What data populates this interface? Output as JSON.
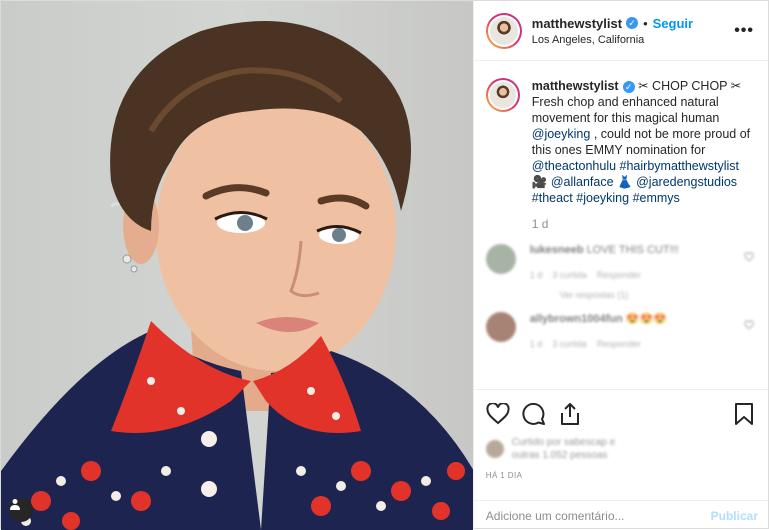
{
  "header": {
    "username": "matthewstylist",
    "verified_icon": "verified-badge-icon",
    "separator": "•",
    "follow_label": "Seguir",
    "location": "Los Angeles, California",
    "more_label": "•••"
  },
  "caption": {
    "username": "matthewstylist",
    "text_1": "✂ CHOP CHOP ✂",
    "text_2": "Fresh chop and enhanced natural movement for this magical human",
    "tag_joey": "@joeyking",
    "text_3": ", could not be more proud of this ones EMMY nomination for",
    "tag_act": "@theactonhulu",
    "tag_hair": "#hairbymatthewstylist",
    "emoji_1": "🎥",
    "tag_allan": "@allanface",
    "emoji_2": "👗",
    "tag_jared": "@jaredengstudios",
    "tag_theact": "#theact",
    "tag_joeyking": "#joeyking",
    "tag_emmys": "#emmys",
    "time": "1 d"
  },
  "comments": [
    {
      "username": "lukesneeb",
      "text": "LOVE THIS CUT!!!",
      "age": "1 d",
      "likes": "3 curtida",
      "reply": "Responder",
      "replies": "Ver respostas (1)"
    },
    {
      "username": "allybrown1004fun",
      "text": "😍😍😍",
      "age": "1 d",
      "likes": "3 curtida",
      "reply": "Responder"
    }
  ],
  "actions": {
    "like_icon": "heart-icon",
    "comment_icon": "comment-icon",
    "share_icon": "share-icon",
    "save_icon": "bookmark-icon",
    "likes_line_1": "Curtido por sabescap e",
    "likes_line_2": "outras 1.052 pessoas",
    "posted": "HÁ 1 DIA"
  },
  "add_comment": {
    "placeholder": "Adicione um comentário...",
    "publish_label": "Publicar"
  },
  "colors": {
    "accent": "#0095f6",
    "link": "#00376b",
    "muted": "#8e8e8e",
    "publish_disabled": "#b2dffc"
  }
}
